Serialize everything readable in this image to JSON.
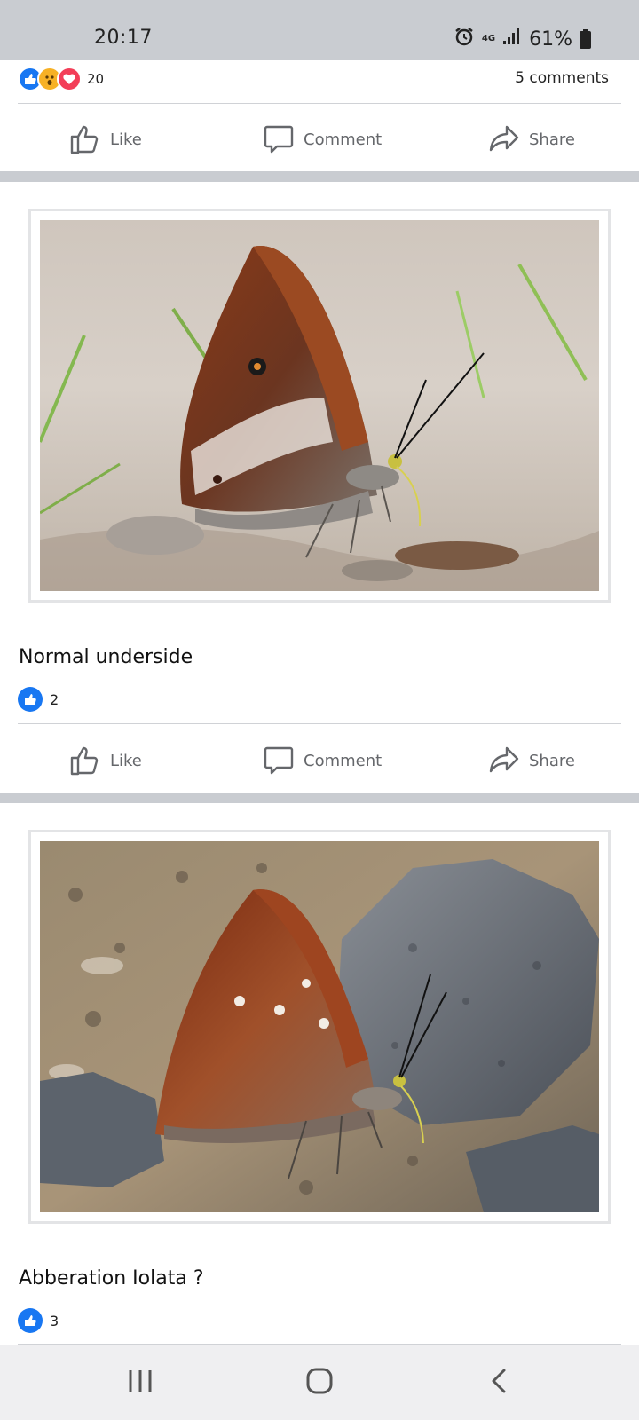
{
  "status_bar": {
    "time": "20:17",
    "network": "4G",
    "battery": "61%"
  },
  "post_top": {
    "reaction_count": "20",
    "comments": "5 comments"
  },
  "actions": {
    "like": "Like",
    "comment": "Comment",
    "share": "Share"
  },
  "photos": [
    {
      "caption": "Normal underside",
      "likes": "2"
    },
    {
      "caption": "Abberation Iolata ?",
      "likes": "3"
    }
  ],
  "colors": {
    "accent": "#1877f2",
    "wow": "#f7b125",
    "love": "#f33e58",
    "separator": "#c9ccd1"
  },
  "icons": [
    "alarm-icon",
    "signal-icon",
    "battery-icon",
    "like-reaction-icon",
    "wow-reaction-icon",
    "love-reaction-icon",
    "thumbs-up-icon",
    "comment-icon",
    "share-icon",
    "recent-apps-icon",
    "home-icon",
    "back-icon"
  ]
}
